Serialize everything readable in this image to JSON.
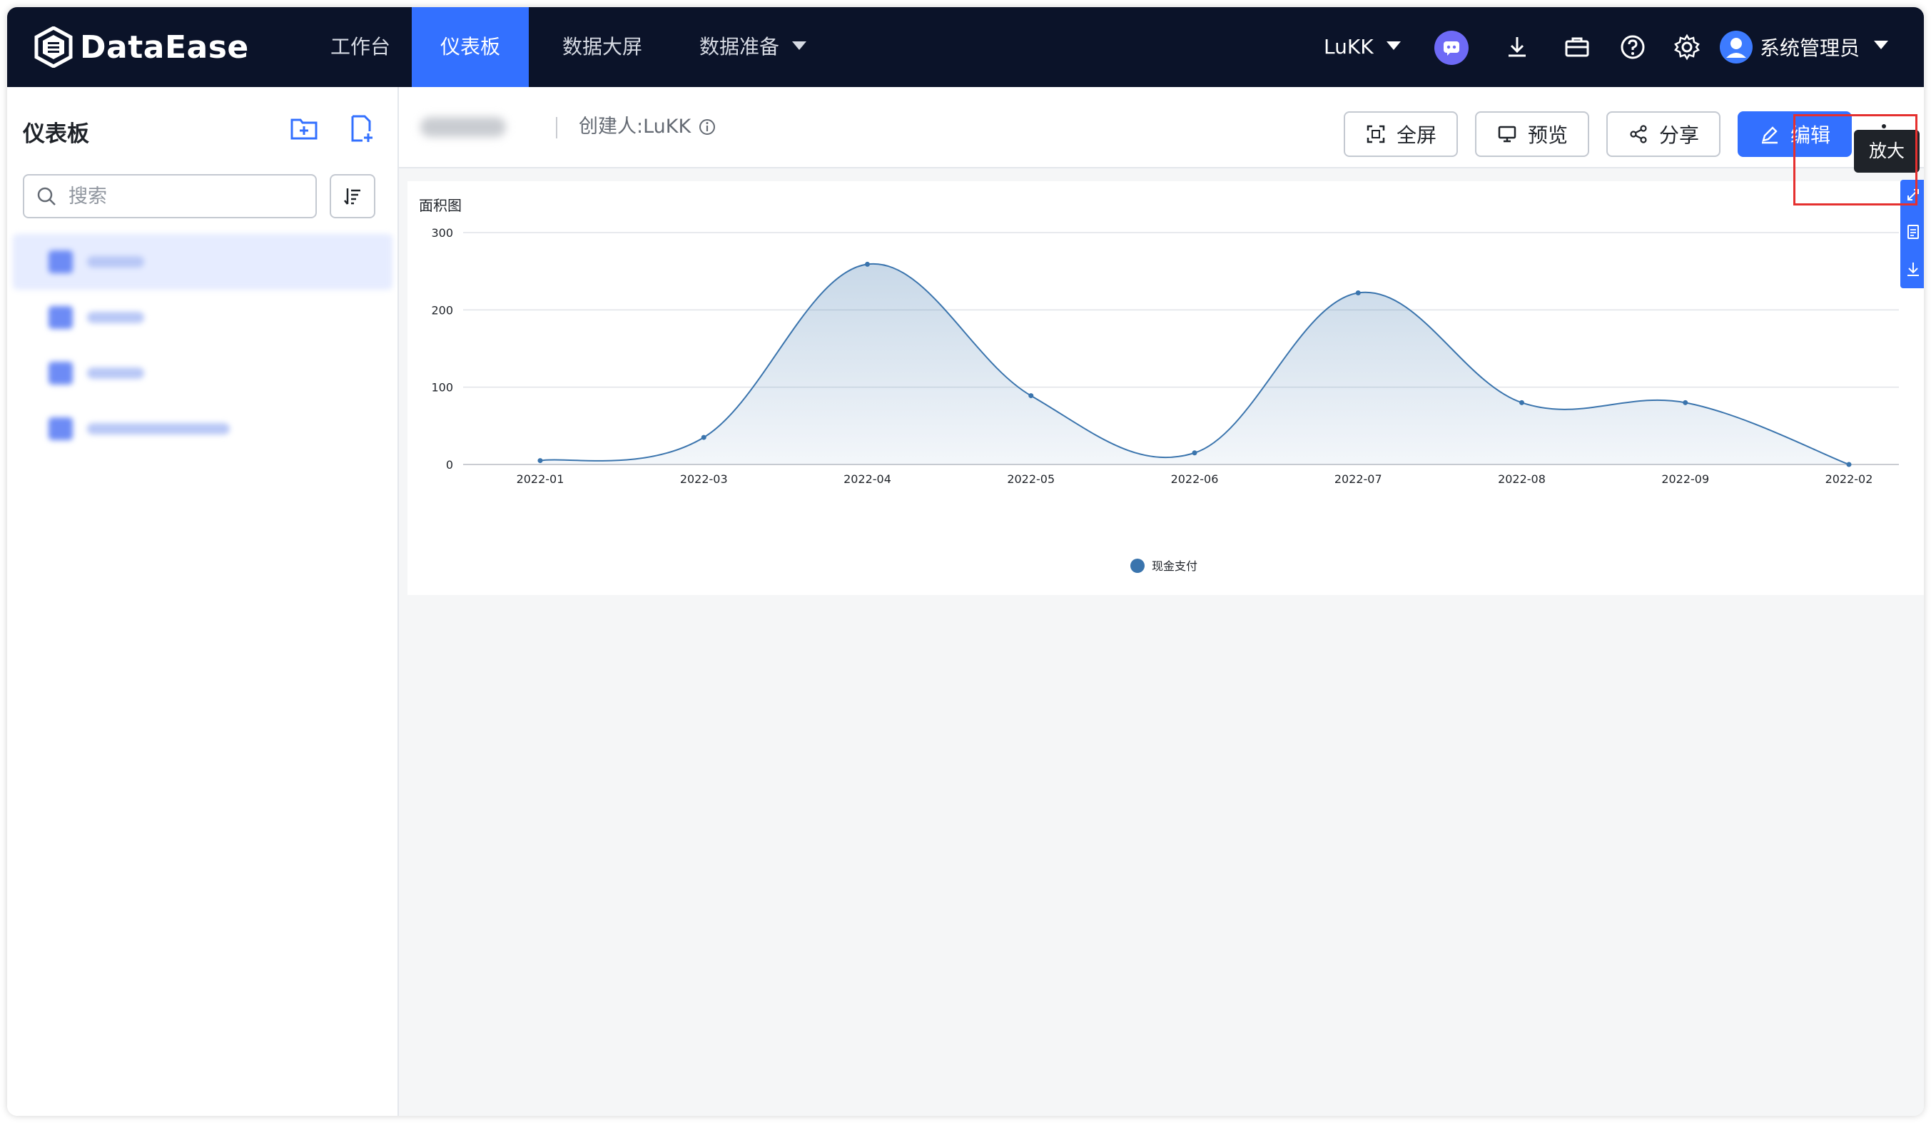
{
  "app": {
    "logo_text": "DataEase",
    "nav": [
      "工作台",
      "仪表板",
      "数据大屏",
      "数据准备"
    ],
    "org": "LuKK",
    "user": "系统管理员",
    "colors": {
      "topbar": "#0b1329",
      "accent": "#3370ff",
      "highlight": "#e5302f"
    }
  },
  "sidebar": {
    "title": "仪表板",
    "search_placeholder": "搜索"
  },
  "toolbar": {
    "creator": "创建人:LuKK",
    "fullscreen": "全屏",
    "preview": "预览",
    "share": "分享",
    "edit": "编辑",
    "tooltip": "放大"
  },
  "chart_data": {
    "type": "area",
    "title": "面积图",
    "categories": [
      "2022-01",
      "2022-03",
      "2022-04",
      "2022-05",
      "2022-06",
      "2022-07",
      "2022-08",
      "2022-09",
      "2022-02"
    ],
    "series": [
      {
        "name": "现金支付",
        "values": [
          5,
          35,
          259,
          89,
          15,
          222,
          80,
          80,
          0
        ],
        "color": "#3a74ad"
      }
    ],
    "yticks": [
      0,
      100,
      200,
      300
    ],
    "ylim": [
      0,
      300
    ],
    "grid": true,
    "smooth": true,
    "legend": "bottom-center"
  }
}
